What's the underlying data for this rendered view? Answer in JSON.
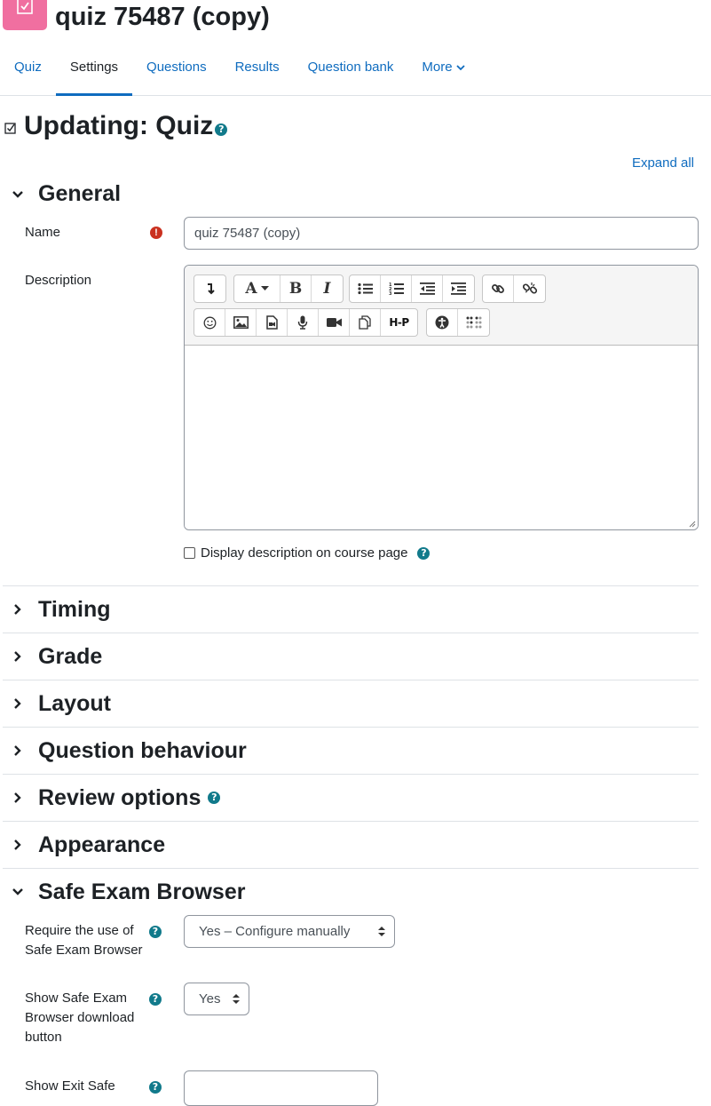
{
  "header": {
    "title": "quiz 75487 (copy)",
    "tabs": [
      {
        "label": "Quiz",
        "active": false
      },
      {
        "label": "Settings",
        "active": true
      },
      {
        "label": "Questions",
        "active": false
      },
      {
        "label": "Results",
        "active": false
      },
      {
        "label": "Question bank",
        "active": false
      },
      {
        "label": "More",
        "active": false,
        "dropdown": true
      }
    ]
  },
  "page": {
    "heading": "Updating: Quiz",
    "expand_all": "Expand all"
  },
  "sections": {
    "general": "General",
    "timing": "Timing",
    "grade": "Grade",
    "layout": "Layout",
    "question_behaviour": "Question behaviour",
    "review_options": "Review options",
    "appearance": "Appearance",
    "seb": "Safe Exam Browser"
  },
  "form": {
    "name_label": "Name",
    "name_value": "quiz 75487 (copy)",
    "description_label": "Description",
    "display_description": "Display description on course page",
    "seb_require_label": "Require the use of Safe Exam Browser",
    "seb_require_value": "Yes – Configure manually",
    "seb_download_label": "Show Safe Exam Browser download button",
    "seb_download_value": "Yes",
    "seb_exit_label": "Show Exit Safe"
  },
  "toolbar": {
    "h5p_label": "H-P"
  },
  "colors": {
    "accent": "#0f6cbf",
    "activity_icon": "#f06fa0",
    "required": "#ca3120",
    "help": "#117a8b"
  }
}
